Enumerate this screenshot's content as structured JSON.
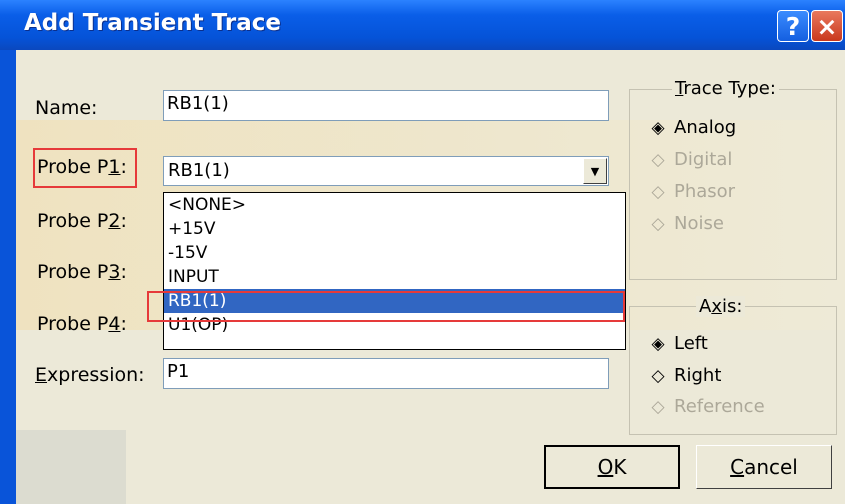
{
  "window": {
    "title": "Add Transient Trace",
    "help_label": "?",
    "close_label": "×"
  },
  "form": {
    "name_label": "Name:",
    "name_value": "RB1(1)",
    "probe_p1_label": "Probe P1:",
    "probe_p1_value": "RB1(1)",
    "probe_p2_label": "Probe P2:",
    "probe_p3_label": "Probe P3:",
    "probe_p4_label": "Probe P4:",
    "expression_label": "Expression:",
    "expression_value": "P1"
  },
  "dropdown": {
    "items": [
      "<NONE>",
      "+15V",
      "-15V",
      "INPUT",
      "RB1(1)",
      "U1(OP)"
    ],
    "selected_index": 4
  },
  "trace_type": {
    "title": "Trace Type:",
    "options": [
      "Analog",
      "Digital",
      "Phasor",
      "Noise"
    ],
    "selected": "Analog"
  },
  "axis": {
    "title": "Axis:",
    "options": [
      "Left",
      "Right",
      "Reference"
    ],
    "selected": "Left"
  },
  "buttons": {
    "ok": "OK",
    "cancel": "Cancel"
  },
  "colors": {
    "title_bar": "#0a5ee8",
    "selection": "#3166c2",
    "highlight_box": "#e63a3a",
    "dialog_bg": "#ece9d8"
  }
}
